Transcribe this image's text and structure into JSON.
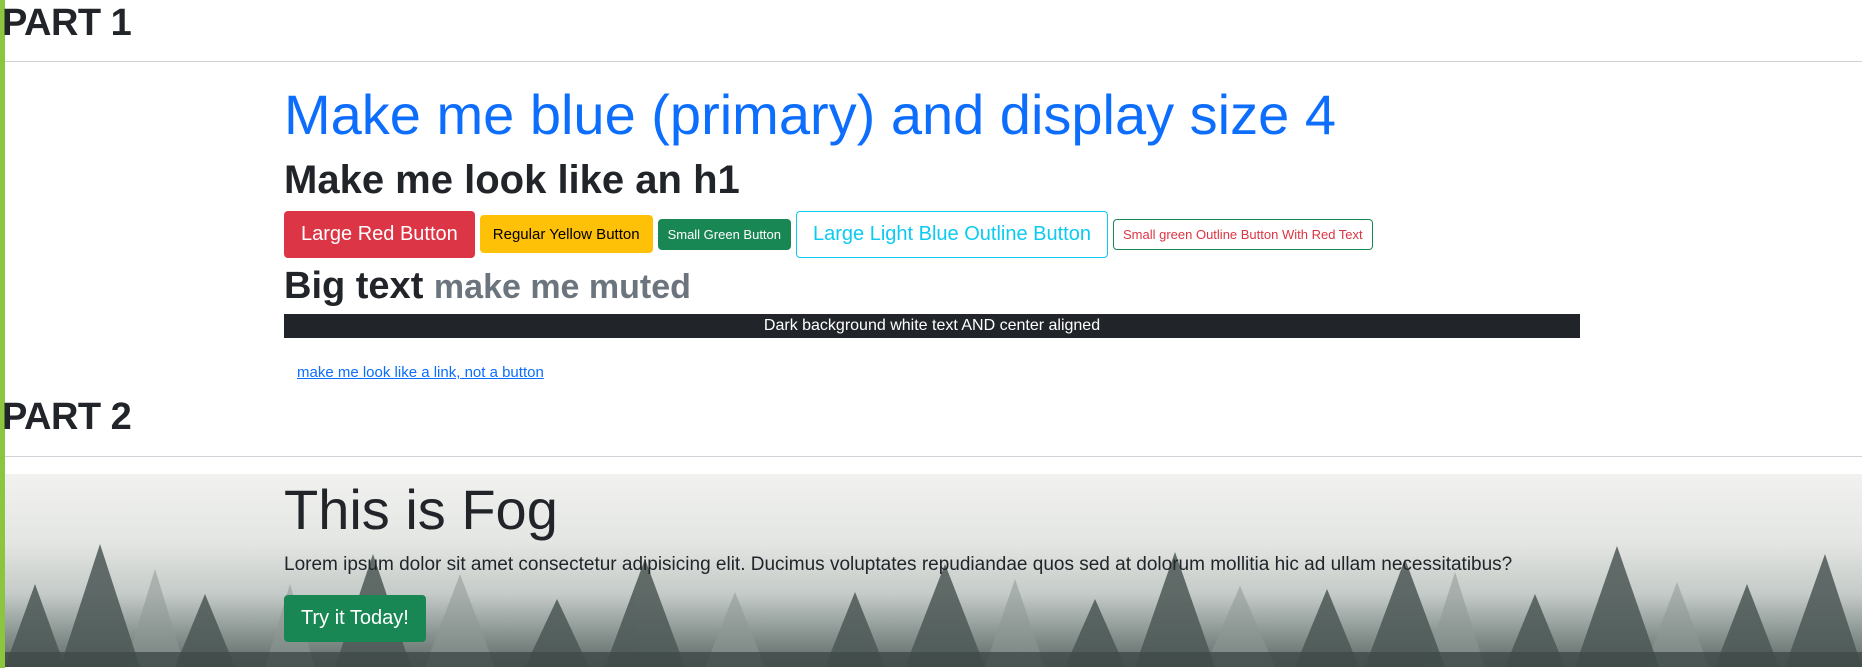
{
  "part1": {
    "heading": "PART 1",
    "display_text": "Make me blue (primary) and display size 4",
    "h1_text": "Make me look like an h1",
    "buttons": {
      "large_red": "Large Red Button",
      "regular_yellow": "Regular Yellow Button",
      "small_green": "Small Green Button",
      "large_light_blue_outline": "Large Light Blue Outline Button",
      "small_green_outline_red_text": "Small green Outline Button With Red Text"
    },
    "big_text": "Big text",
    "muted_text": "make me muted",
    "dark_bar_text": "Dark background white text AND center aligned",
    "link_button_text": "make me look like a link, not a button"
  },
  "part2": {
    "heading": "PART 2",
    "hero": {
      "title": "This is Fog",
      "lead": "Lorem ipsum dolor sit amet consectetur adipisicing elit. Ducimus voluptates repudiandae quos sed at dolorum mollitia hic ad ullam necessitatibus?",
      "cta_label": "Try it Today!"
    }
  },
  "colors": {
    "accent_bar": "#8cc63f",
    "primary": "#0d6efd",
    "danger": "#dc3545",
    "warning": "#ffc107",
    "success": "#198754",
    "info": "#0dcaf0",
    "dark": "#212529",
    "muted": "#6c757d"
  }
}
